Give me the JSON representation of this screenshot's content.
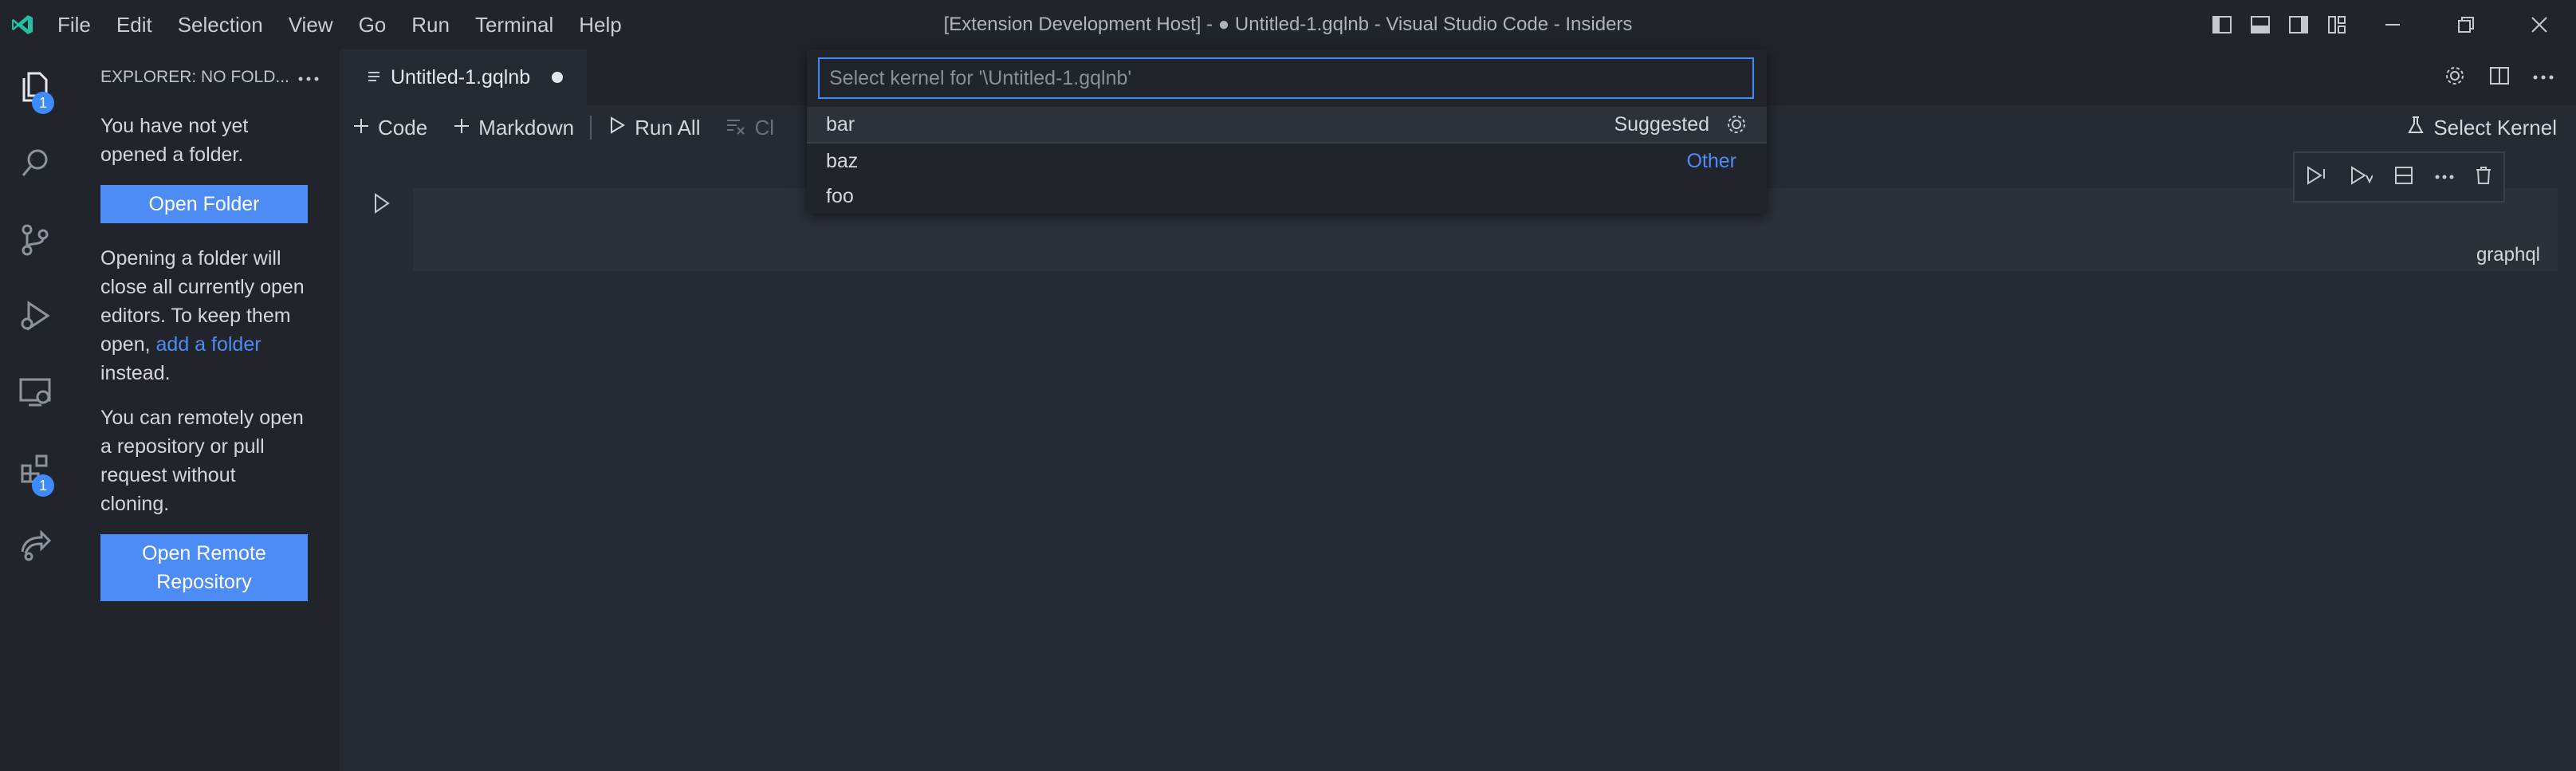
{
  "window": {
    "title": "[Extension Development Host] - ● Untitled-1.gqlnb - Visual Studio Code - Insiders"
  },
  "menu": [
    "File",
    "Edit",
    "Selection",
    "View",
    "Go",
    "Run",
    "Terminal",
    "Help"
  ],
  "activity_bar": {
    "explorer_badge": "1",
    "extensions_badge": "1"
  },
  "sidebar": {
    "header": "EXPLORER: NO FOLD...",
    "no_folder_text": "You have not yet opened a folder.",
    "open_folder_label": "Open Folder",
    "warning_prefix": "Opening a folder will close all currently open editors. To keep them open, ",
    "add_folder_link": "add a folder",
    "warning_suffix": " instead.",
    "remote_text": "You can remotely open a repository or pull request without cloning.",
    "open_remote_label": "Open Remote Repository"
  },
  "editor": {
    "tab_label": "Untitled-1.gqlnb",
    "toolbar": {
      "code_label": "Code",
      "markdown_label": "Markdown",
      "run_all_label": "Run All",
      "clear_label": "Cl",
      "select_kernel_label": "Select Kernel"
    },
    "cell_language": "graphql"
  },
  "quick_pick": {
    "placeholder": "Select kernel for '\\Untitled-1.gqlnb'",
    "items": [
      {
        "label": "bar",
        "detail": "Suggested",
        "selected": true
      },
      {
        "label": "baz",
        "detail": "Other"
      },
      {
        "label": "foo",
        "detail": ""
      }
    ]
  },
  "colors": {
    "accent": "#3d8bfd",
    "button": "#4d8cf5",
    "background": "#262a33",
    "sidebar": "#21252b"
  }
}
